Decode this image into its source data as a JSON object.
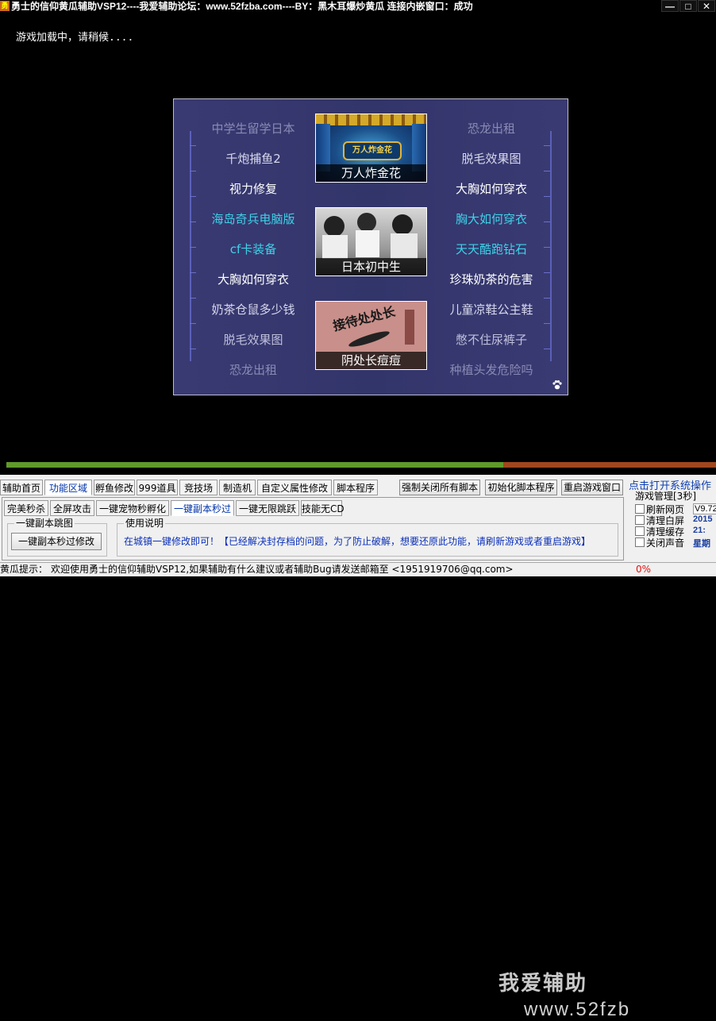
{
  "window": {
    "title": "勇士的信仰黄瓜辅助VSP12----我爱辅助论坛：www.52fzba.com----BY：黑木耳爆炒黄瓜     连接内嵌窗口：成功",
    "min_label": "—",
    "max_label": "□",
    "close_label": "✕"
  },
  "game": {
    "loading_text": "游戏加载中，请稍候...."
  },
  "ad_panel": {
    "left_items": [
      {
        "label": "中学生留学日本",
        "color": "#8a8ab4"
      },
      {
        "label": "千炮捕鱼2",
        "color": "#d8d8ee"
      },
      {
        "label": "视力修复",
        "color": "#ffffff"
      },
      {
        "label": "海岛奇兵电脑版",
        "color": "#3fd2e8"
      },
      {
        "label": "cf卡装备",
        "color": "#3fd2e8"
      },
      {
        "label": "大胸如何穿衣",
        "color": "#ffffff"
      },
      {
        "label": "奶茶仓鼠多少钱",
        "color": "#d8d8ee"
      },
      {
        "label": "脱毛效果图",
        "color": "#c0c0dc"
      },
      {
        "label": "恐龙出租",
        "color": "#8a8ab4"
      }
    ],
    "right_items": [
      {
        "label": "恐龙出租",
        "color": "#8a8ab4"
      },
      {
        "label": "脱毛效果图",
        "color": "#d8d8ee"
      },
      {
        "label": "大胸如何穿衣",
        "color": "#ffffff"
      },
      {
        "label": "胸大如何穿衣",
        "color": "#3fd2e8"
      },
      {
        "label": "天天酷跑钻石",
        "color": "#3fd2e8"
      },
      {
        "label": "珍珠奶茶的危害",
        "color": "#ffffff"
      },
      {
        "label": "儿童凉鞋公主鞋",
        "color": "#d8d8ee"
      },
      {
        "label": "憋不住尿裤子",
        "color": "#c0c0dc"
      },
      {
        "label": "种植头发危险吗",
        "color": "#8a8ab4"
      }
    ],
    "images": [
      {
        "caption": "万人炸金花",
        "logo_text": "万人炸金花"
      },
      {
        "caption": "日本初中生"
      },
      {
        "caption": "阴处长痘痘",
        "cover_text": "接待处处长"
      }
    ]
  },
  "progress": {
    "value": 0.7
  },
  "main_tabs": [
    "辅助首页",
    "功能区域",
    "孵鱼修改",
    "999道具",
    "竞技场",
    "制造机",
    "自定义属性修改",
    "脚本程序"
  ],
  "main_tabs_active": 1,
  "action_buttons": [
    "强制关闭所有脚本",
    "初始化脚本程序",
    "重启游戏窗口"
  ],
  "system_link": "点击打开系统操作",
  "sub_tabs": [
    "完美秒杀",
    "全屏攻击",
    "一键宠物秒孵化",
    "一键副本秒过",
    "一键无限跳跃",
    "技能无CD"
  ],
  "sub_tabs_active": 3,
  "dungeon_group": {
    "legend": "一键副本跳图",
    "button": "一键副本秒过修改"
  },
  "usage_group": {
    "legend": "使用说明",
    "text": "在城镇一键修改即可！【已经解决封存档的问题，为了防止破解，想要还原此功能，请刷新游戏或者重启游戏】"
  },
  "game_mgmt": {
    "title": "游戏管理[3秒]",
    "options": [
      "刷新网页",
      "清理白屏",
      "清理缓存",
      "关闭声音"
    ],
    "values": [
      "V9.72",
      "2015",
      "21:",
      "星期"
    ]
  },
  "watermark": {
    "line1": "我爱辅助",
    "line2": "www.52fzb"
  },
  "status": {
    "label": "黄瓜提示：",
    "text": "欢迎使用勇士的信仰辅助VSP12,如果辅助有什么建议或者辅助Bug请发送邮箱至 <1951919706@qq.com>",
    "percent": "0%"
  },
  "colors": {
    "panel_bg": "#353569",
    "accent_cyan": "#3fd2e8",
    "progress_done": "#5f9a2a",
    "progress_rest": "#a0461e",
    "link_blue": "#0033aa",
    "status_red": "#e01010"
  },
  "icons": [
    "game-app-icon",
    "paw-icon"
  ]
}
